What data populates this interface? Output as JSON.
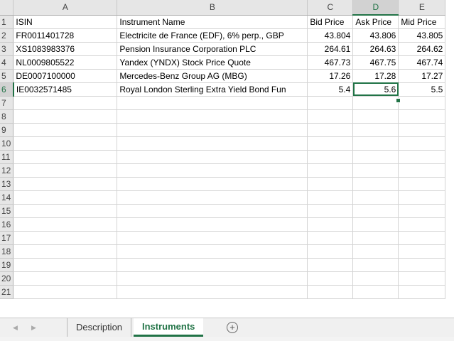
{
  "columns": [
    "A",
    "B",
    "C",
    "D",
    "E"
  ],
  "selected_column": "D",
  "selected_row": 6,
  "row_numbers": [
    "1",
    "2",
    "3",
    "4",
    "5",
    "6",
    "7",
    "8",
    "9",
    "10",
    "11",
    "12",
    "13",
    "14",
    "15",
    "16",
    "17",
    "18",
    "19",
    "20",
    "21"
  ],
  "headers": {
    "isin": "ISIN",
    "name": "Instrument Name",
    "bid": "Bid Price",
    "ask": "Ask Price",
    "mid": "Mid Price"
  },
  "rows": [
    {
      "isin": "FR0011401728",
      "name": "Electricite de France (EDF), 6% perp., GBP",
      "bid": "43.804",
      "ask": "43.806",
      "mid": "43.805"
    },
    {
      "isin": "XS1083983376",
      "name": "Pension Insurance Corporation PLC",
      "bid": "264.61",
      "ask": "264.63",
      "mid": "264.62"
    },
    {
      "isin": "NL0009805522",
      "name": "Yandex (YNDX) Stock Price Quote",
      "bid": "467.73",
      "ask": "467.75",
      "mid": "467.74"
    },
    {
      "isin": "DE0007100000",
      "name": "Mercedes-Benz Group AG (MBG)",
      "bid": "17.26",
      "ask": "17.28",
      "mid": "17.27"
    },
    {
      "isin": "IE0032571485",
      "name": "Royal London Sterling Extra Yield Bond Fun",
      "bid": "5.4",
      "ask": "5.6",
      "mid": "5.5"
    }
  ],
  "sheet_tabs": [
    {
      "label": "Description",
      "active": false
    },
    {
      "label": "Instruments",
      "active": true
    }
  ],
  "add_sheet_symbol": "+",
  "nav_prev_symbol": "◀",
  "nav_next_symbol": "▶",
  "colors": {
    "accent": "#217346",
    "header_bg": "#e6e6e6",
    "gridline": "#d4d4d4"
  }
}
